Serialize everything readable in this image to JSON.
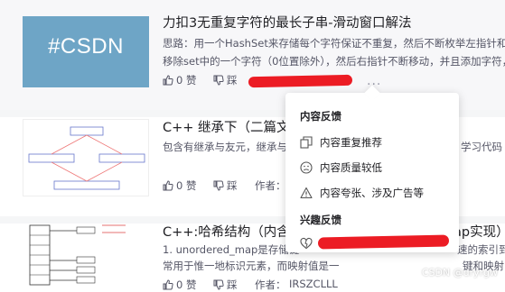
{
  "articles": [
    {
      "thumb_text": "#CSDN",
      "title": "力扣3无重复字符的最长子串-滑动窗口解法",
      "desc_line1": "思路：用一个HashSet来存储每个字符保证不重复，然后不断枚举左指针和右",
      "desc_line2": "移除set中的一个字符（0位置除外），然后右指针不断移动，并且添加字符，",
      "likes": "0 赞",
      "dislike": "踩"
    },
    {
      "title": "C++ 继承下（二篇文章",
      "desc_line1": "包含有继承与友元，继承与静",
      "desc_tail": "学习代码",
      "likes": "0 赞",
      "dislike": "踩",
      "author_label": "作者："
    },
    {
      "title": "C++:哈希结构（内含u",
      "title_tail": "ap实现）",
      "desc_line1": "1. unordered_map是存储键",
      "desc_tail1": "速的索引到",
      "desc_line2": "常用于惟一地标识元素，而映射值是一",
      "desc_tail2": "键和映射",
      "likes": "0 赞",
      "dislike": "踩",
      "author_label": "作者：",
      "author_partial": "IRSZCLLL"
    }
  ],
  "popup": {
    "section1_title": "内容反馈",
    "options": [
      "内容重复推荐",
      "内容质量较低",
      "内容夸张、涉及广告等"
    ],
    "section2_title": "兴趣反馈"
  },
  "watermark": "CSDN @dryrgw",
  "more_dots": "···",
  "colors": {
    "redaction": "#ec1c24",
    "thumb_csdn": "#6ea5c6",
    "muted_text": "#555666"
  }
}
